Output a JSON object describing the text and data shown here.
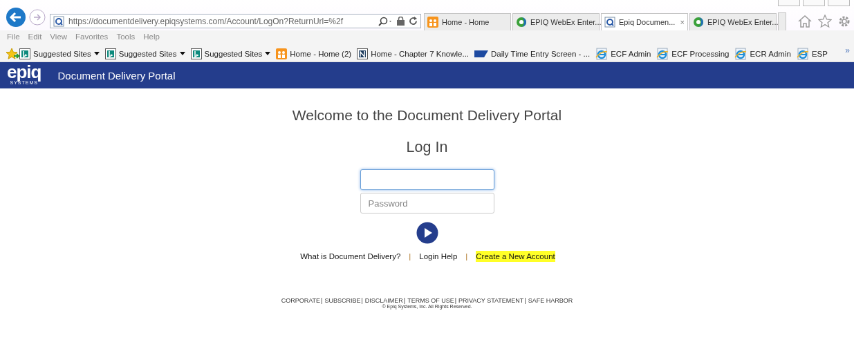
{
  "browser": {
    "address": "https://documentdelivery.epiqsystems.com/Account/LogOn?ReturnUrl=%2f",
    "tabs": [
      {
        "label": "Home - Home",
        "kind": "home",
        "selected": false
      },
      {
        "label": "EPIQ WebEx Enter...",
        "kind": "webex",
        "selected": false
      },
      {
        "label": "Epiq Documen...",
        "kind": "page",
        "selected": true,
        "close": "×"
      },
      {
        "label": "EPIQ WebEx Enter...",
        "kind": "webex",
        "selected": false
      }
    ],
    "menu": [
      "File",
      "Edit",
      "View",
      "Favorites",
      "Tools",
      "Help"
    ],
    "favorites": [
      {
        "label": "Suggested Sites",
        "kind": "bing"
      },
      {
        "label": "Suggested Sites",
        "kind": "bing"
      },
      {
        "label": "Suggested Sites",
        "kind": "bing"
      },
      {
        "label": "Home - Home (2)",
        "kind": "home"
      },
      {
        "label": "Home - Chapter 7 Knowle...",
        "kind": "chapter"
      },
      {
        "label": "Daily Time Entry Screen - ...",
        "kind": "sap"
      },
      {
        "label": "ECF Admin",
        "kind": "ie"
      },
      {
        "label": "ECF Processing",
        "kind": "ie"
      },
      {
        "label": "ECR Admin",
        "kind": "ie"
      },
      {
        "label": "ESP",
        "kind": "ie"
      }
    ],
    "overflow": "»"
  },
  "header": {
    "logo": "epiq",
    "logo_sub": "SYSTEMS",
    "title": "Document Delivery Portal"
  },
  "login": {
    "welcome": "Welcome to the Document Delivery Portal",
    "heading": "Log In",
    "username": {
      "focused": true
    },
    "password": {
      "placeholder": "Password"
    }
  },
  "links": [
    {
      "kind": "link",
      "label": "What is Document Delivery?",
      "highlighted": false
    },
    {
      "kind": "separator",
      "label": "|"
    },
    {
      "kind": "link",
      "label": "Login Help",
      "highlighted": false
    },
    {
      "kind": "separator",
      "label": "|"
    },
    {
      "kind": "link",
      "label": "Create a New Account",
      "highlighted": true
    }
  ],
  "footer": {
    "links": [
      {
        "kind": "link",
        "label": "CORPORATE"
      },
      {
        "kind": "separator",
        "label": "|"
      },
      {
        "kind": "link",
        "label": "SUBSCRIBE"
      },
      {
        "kind": "separator",
        "label": "|"
      },
      {
        "kind": "link",
        "label": "DISCLAIMER"
      },
      {
        "kind": "separator",
        "label": "|"
      },
      {
        "kind": "link",
        "label": "TERMS OF USE"
      },
      {
        "kind": "separator",
        "label": "|"
      },
      {
        "kind": "link",
        "label": "PRIVACY STATEMENT"
      },
      {
        "kind": "separator",
        "label": "|"
      },
      {
        "kind": "link",
        "label": "SAFE HARBOR"
      }
    ],
    "copyright": "© Epiq Systems, Inc. All Rights Reserved."
  }
}
